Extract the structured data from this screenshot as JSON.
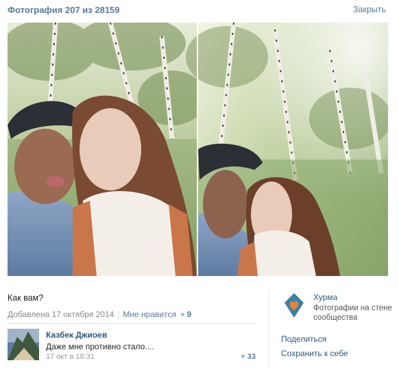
{
  "header": {
    "title": "Фотография 207 из 28159",
    "close_label": "Закрыть"
  },
  "post": {
    "caption": "Как вам?",
    "added": "Добавлена 17 октября 2014",
    "like_label": "Мне нравится",
    "like_count": "9"
  },
  "comment": {
    "author": "Казбек Джиоев",
    "text": "Даже мне противно стало....",
    "time": "17 окт в 18:31",
    "like_count": "33"
  },
  "group": {
    "name": "Хурма",
    "description": "Фотографии на стене сообщества"
  },
  "actions": {
    "share_label": "Поделиться",
    "save_label": "Сохранить к себе"
  },
  "colors": {
    "link": "#2b587a",
    "header_text": "#5b7a9b",
    "group_icon": "#3e7fa5",
    "group_heart": "#e8843c"
  }
}
